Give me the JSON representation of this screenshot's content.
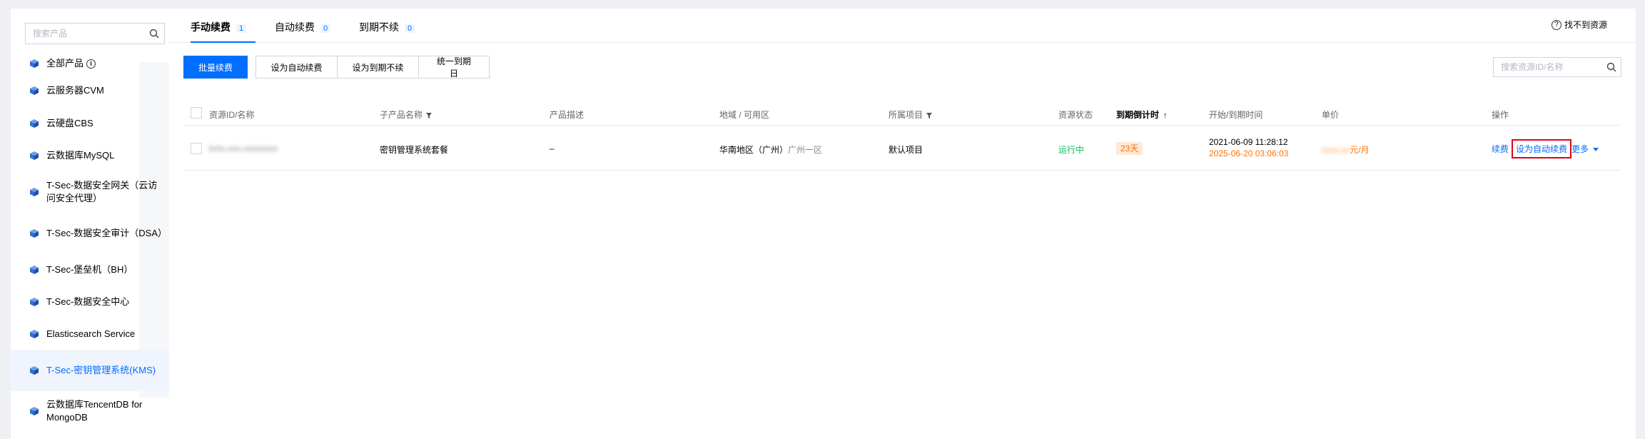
{
  "sidebar": {
    "search_placeholder": "搜索产品",
    "items": [
      {
        "label": "全部产品",
        "has_info": true
      },
      {
        "label": "云服务器CVM"
      },
      {
        "label": "云硬盘CBS"
      },
      {
        "label": "云数据库MySQL"
      },
      {
        "label": "T-Sec-数据安全网关（云访问安全代理）"
      },
      {
        "label": "T-Sec-数据安全审计（DSA）"
      },
      {
        "label": "T-Sec-堡垒机（BH）"
      },
      {
        "label": "T-Sec-数据安全中心"
      },
      {
        "label": "Elasticsearch Service"
      },
      {
        "label": "T-Sec-密钥管理系统(KMS)",
        "active": true
      },
      {
        "label": "云数据库TencentDB for MongoDB"
      }
    ]
  },
  "tabs": [
    {
      "label": "手动续费",
      "count": "1",
      "active": true
    },
    {
      "label": "自动续费",
      "count": "0"
    },
    {
      "label": "到期不续",
      "count": "0"
    }
  ],
  "help": {
    "label": "找不到资源"
  },
  "toolbar": {
    "batch_renew": "批量续费",
    "set_auto": "设为自动续费",
    "set_expire": "设为到期不续",
    "unify_date": "统一到期日"
  },
  "resource_search": {
    "placeholder": "搜索资源ID/名称"
  },
  "table": {
    "headers": {
      "resource_id": "资源ID/名称",
      "sub_product": "子产品名称",
      "description": "产品描述",
      "region": "地域 / 可用区",
      "project": "所属项目",
      "status": "资源状态",
      "countdown": "到期倒计时",
      "time": "开始/到期时间",
      "price": "单价",
      "actions": "操作"
    },
    "rows": [
      {
        "resource_id": "kms-xxx-xxxxxxxx",
        "sub_product": "密钥管理系统套餐",
        "description": "–",
        "region": "华南地区（广州）",
        "zone": "广州一区",
        "project": "默认项目",
        "status": "运行中",
        "countdown": "23天",
        "start_time": "2021-06-09 11:28:12",
        "end_time": "2025-06-20 03:06:03",
        "price_hidden": "xxxx.xx",
        "price_unit": "元/月",
        "action_renew": "续费",
        "action_auto": "设为自动续费",
        "action_more": "更多"
      }
    ]
  },
  "colors": {
    "primary": "#006eff",
    "running": "#0abf5b",
    "warning": "#ff7200",
    "highlight": "#e0001b"
  }
}
